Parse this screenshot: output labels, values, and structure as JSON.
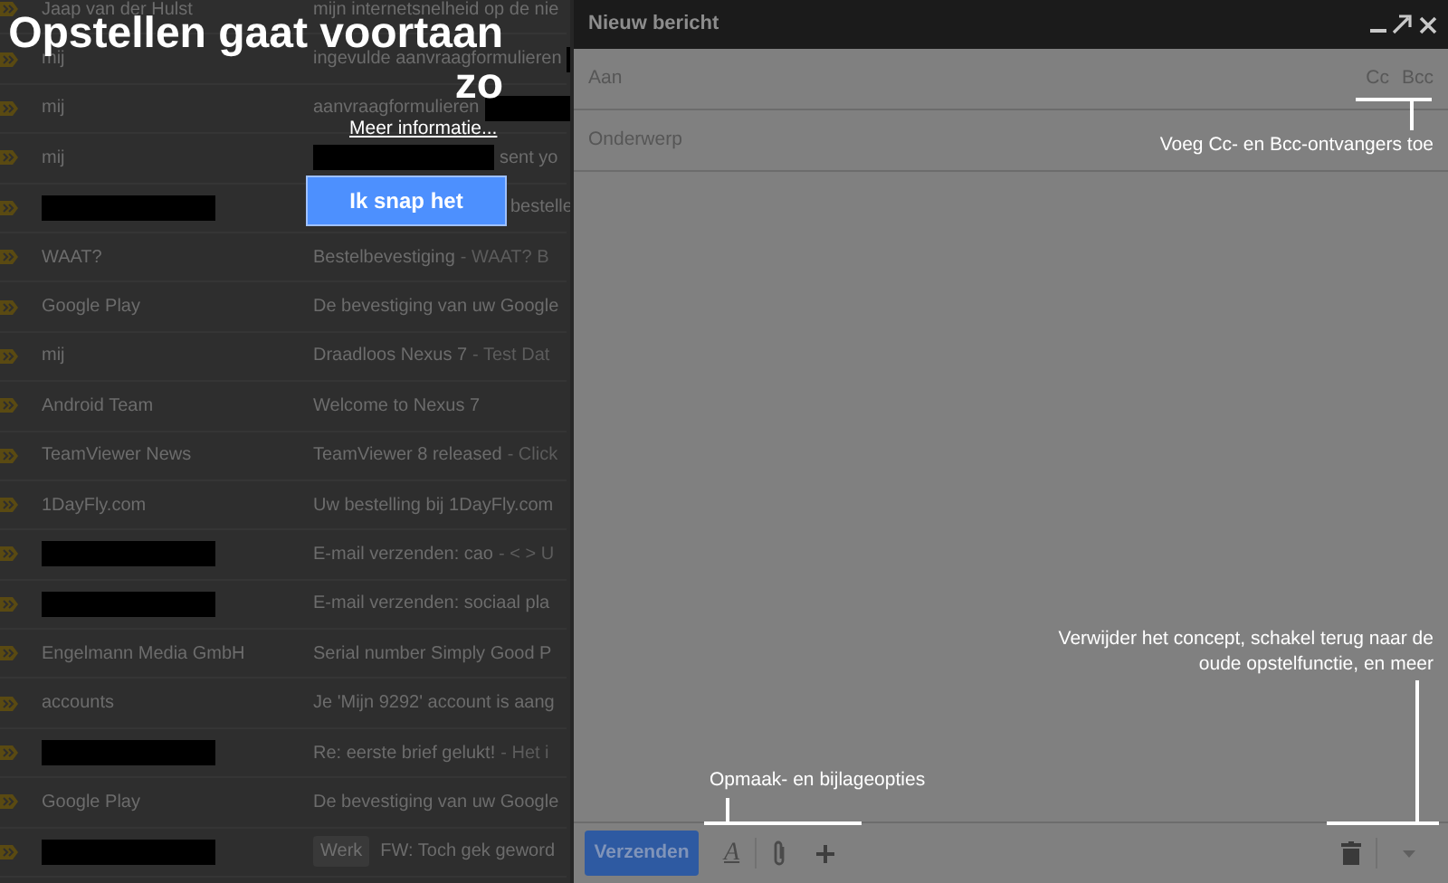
{
  "message_list": {
    "rows": [
      {
        "sender": "Jaap van der Hulst",
        "sender_redacted": false,
        "subject": [
          {
            "kind": "text",
            "text": "mijn internetsnelheid op de nie"
          }
        ]
      },
      {
        "sender": "mij",
        "sender_redacted": false,
        "subject": [
          {
            "kind": "text",
            "text": "ingevulde aanvraagformulieren"
          },
          {
            "kind": "redaction"
          }
        ]
      },
      {
        "sender": "mij",
        "sender_redacted": false,
        "subject": [
          {
            "kind": "text",
            "text": "aanvraagformulieren"
          },
          {
            "kind": "redaction"
          }
        ]
      },
      {
        "sender": "mij",
        "sender_redacted": false,
        "subject": [
          {
            "kind": "redaction"
          },
          {
            "kind": "text",
            "text": "sent yo"
          }
        ]
      },
      {
        "sender_redacted": true,
        "subject": [
          {
            "kind": "covered"
          },
          {
            "kind": "text",
            "text": "bestelle"
          }
        ]
      },
      {
        "sender": "WAAT?",
        "sender_redacted": false,
        "subject": [
          {
            "kind": "text",
            "text": "Bestelbevestiging"
          },
          {
            "kind": "snippet",
            "text": "- WAAT? B"
          }
        ]
      },
      {
        "sender": "Google Play",
        "sender_redacted": false,
        "subject": [
          {
            "kind": "text",
            "text": "De bevestiging van uw Google"
          }
        ]
      },
      {
        "sender": "mij",
        "sender_redacted": false,
        "subject": [
          {
            "kind": "text",
            "text": "Draadloos Nexus 7"
          },
          {
            "kind": "snippet",
            "text": "- Test Dat"
          }
        ]
      },
      {
        "sender": "Android Team",
        "sender_redacted": false,
        "subject": [
          {
            "kind": "text",
            "text": "Welcome to Nexus 7"
          }
        ]
      },
      {
        "sender": "TeamViewer News",
        "sender_redacted": false,
        "subject": [
          {
            "kind": "text",
            "text": "TeamViewer 8 released"
          },
          {
            "kind": "snippet",
            "text": "- Click"
          }
        ]
      },
      {
        "sender": "1DayFly.com",
        "sender_redacted": false,
        "subject": [
          {
            "kind": "text",
            "text": "Uw bestelling bij 1DayFly.com"
          }
        ]
      },
      {
        "sender_redacted": true,
        "subject": [
          {
            "kind": "text",
            "text": "E-mail verzenden: cao"
          },
          {
            "kind": "snippet",
            "text": "- < > U"
          }
        ]
      },
      {
        "sender_redacted": true,
        "subject": [
          {
            "kind": "text",
            "text": "E-mail verzenden: sociaal pla"
          }
        ]
      },
      {
        "sender": "Engelmann Media GmbH",
        "sender_redacted": false,
        "subject": [
          {
            "kind": "text",
            "text": "Serial number Simply Good P"
          }
        ]
      },
      {
        "sender": "accounts",
        "sender_redacted": false,
        "subject": [
          {
            "kind": "text",
            "text": "Je 'Mijn 9292' account is aang"
          }
        ]
      },
      {
        "sender_redacted": true,
        "subject": [
          {
            "kind": "text",
            "text": "Re: eerste brief gelukt!"
          },
          {
            "kind": "snippet",
            "text": "- Het i"
          }
        ]
      },
      {
        "sender": "Google Play",
        "sender_redacted": false,
        "subject": [
          {
            "kind": "text",
            "text": "De bevestiging van uw Google"
          }
        ]
      },
      {
        "sender_redacted": true,
        "subject": [
          {
            "kind": "label",
            "text": "Werk"
          },
          {
            "kind": "text",
            "text": "FW: Toch gek geword"
          }
        ]
      }
    ]
  },
  "intro": {
    "title_lines": [
      "Opstellen gaat voortaan",
      "zo"
    ],
    "link": "Meer informatie...",
    "button": "Ik snap het"
  },
  "compose": {
    "title": "Nieuw bericht",
    "to_field": {
      "placeholder": "Aan"
    },
    "cc_link": "Cc",
    "bcc_link": "Bcc",
    "subject_field": {
      "placeholder": "Onderwerp"
    },
    "send_button": "Verzenden",
    "format_button": "A"
  },
  "callouts": {
    "cc_bcc": "Voeg Cc- en Bcc-ontvangers toe",
    "more_options": "Verwijder het concept, schakel terug naar de oude opstelfunctie, en meer",
    "format_attach": "Opmaak- en bijlageopties"
  }
}
